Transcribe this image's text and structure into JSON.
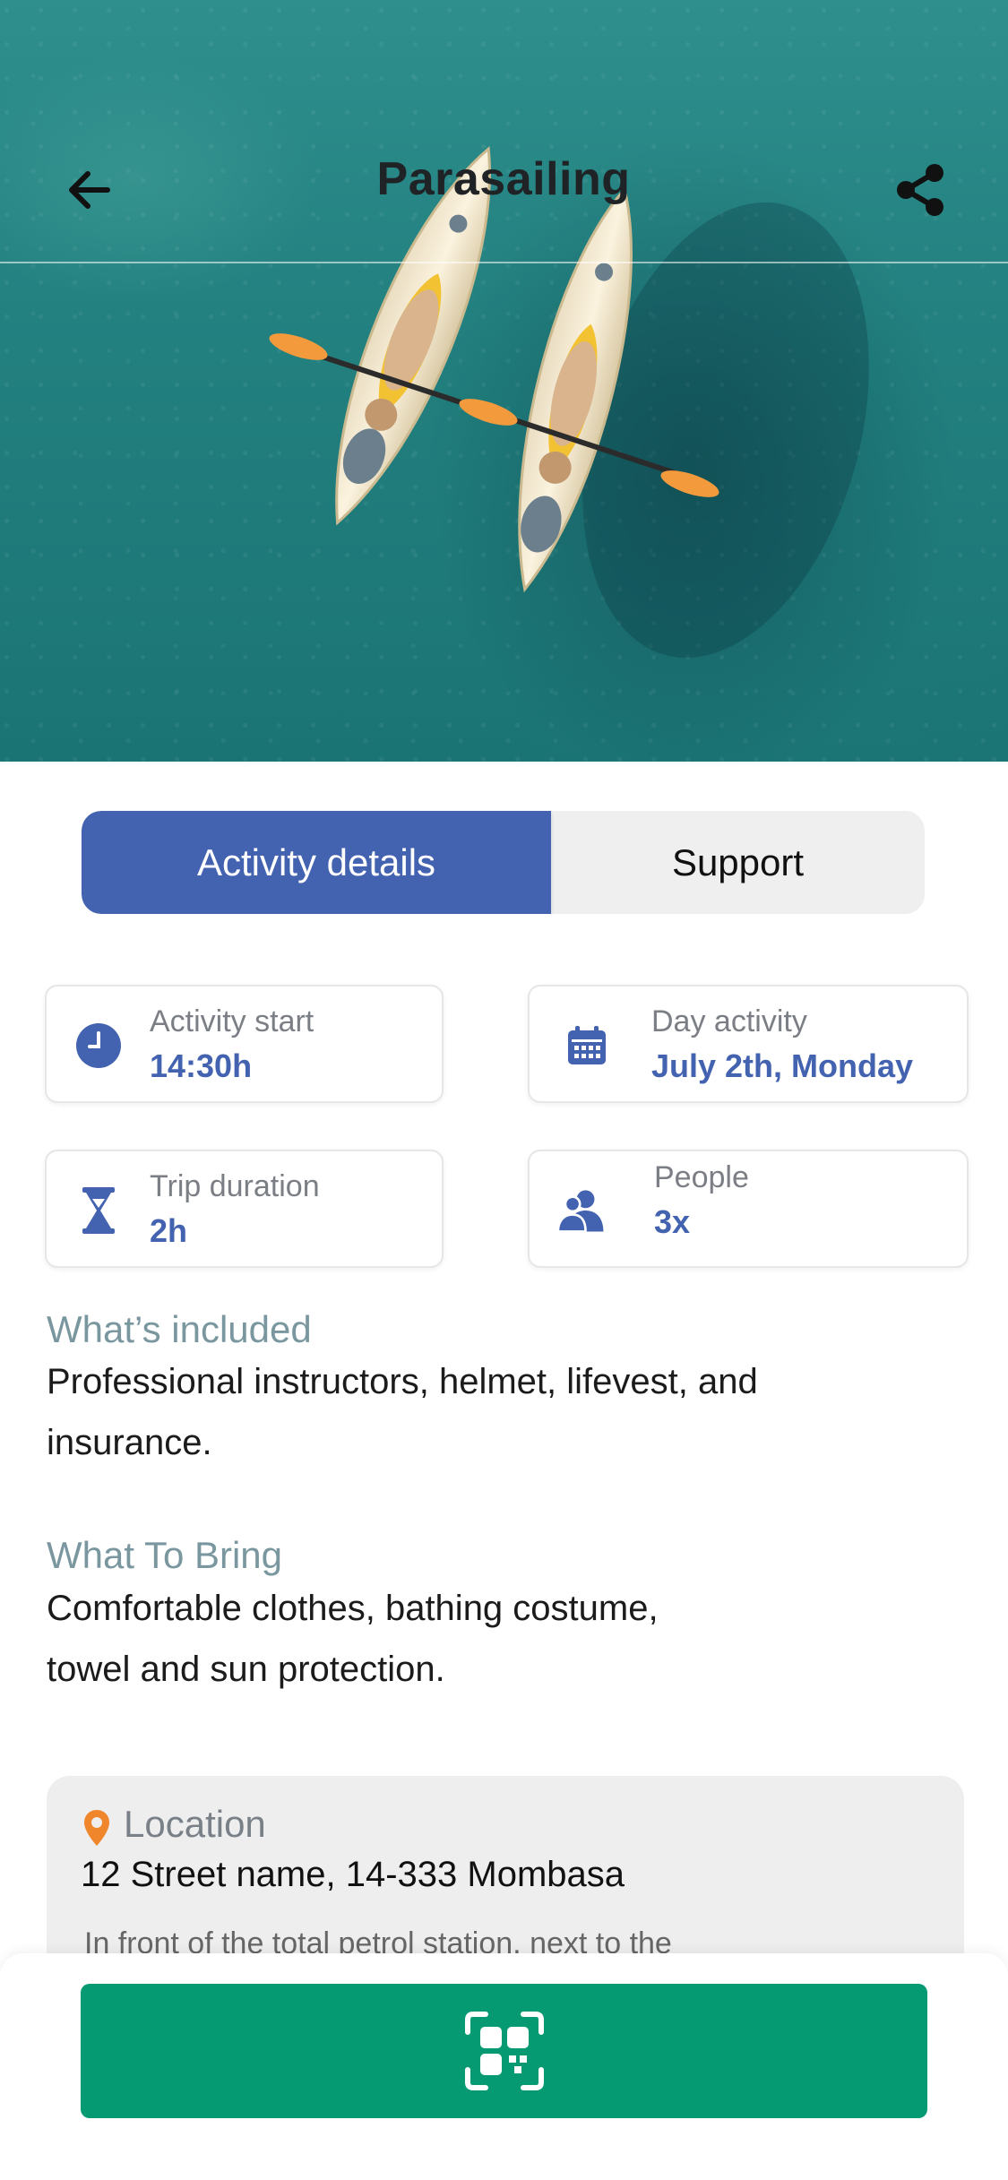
{
  "header": {
    "title": "Parasailing",
    "back_icon": "arrow-left-icon",
    "share_icon": "share-icon"
  },
  "tabs": [
    {
      "label": "Activity details",
      "active": true
    },
    {
      "label": "Support",
      "active": false
    }
  ],
  "info": {
    "start": {
      "label": "Activity start",
      "value": "14:30h",
      "icon": "clock-icon"
    },
    "day": {
      "label": "Day activity",
      "value": "July 2th, Monday",
      "icon": "calendar-icon"
    },
    "duration": {
      "label": "Trip duration",
      "value": "2h",
      "icon": "hourglass-icon"
    },
    "people": {
      "label": "People",
      "value": "3x",
      "icon": "people-icon"
    }
  },
  "included": {
    "heading": "What’s included",
    "line1": "Professional instructors, helmet, lifevest, and",
    "line2": "insurance."
  },
  "bring": {
    "heading": "What To Bring",
    "line1": "Comfortable clothes, bathing costume,",
    "line2": "towel and sun protection."
  },
  "location": {
    "heading": "Location",
    "address": "12 Street name, 14-333 Mombasa",
    "note": "In front of the total petrol station, next to the"
  },
  "bottom_button": {
    "icon": "qr-scan-icon"
  },
  "colors": {
    "primary": "#4363b0",
    "accent_green": "#059a72",
    "section_heading": "#7a979f",
    "pin": "#f0862b"
  }
}
